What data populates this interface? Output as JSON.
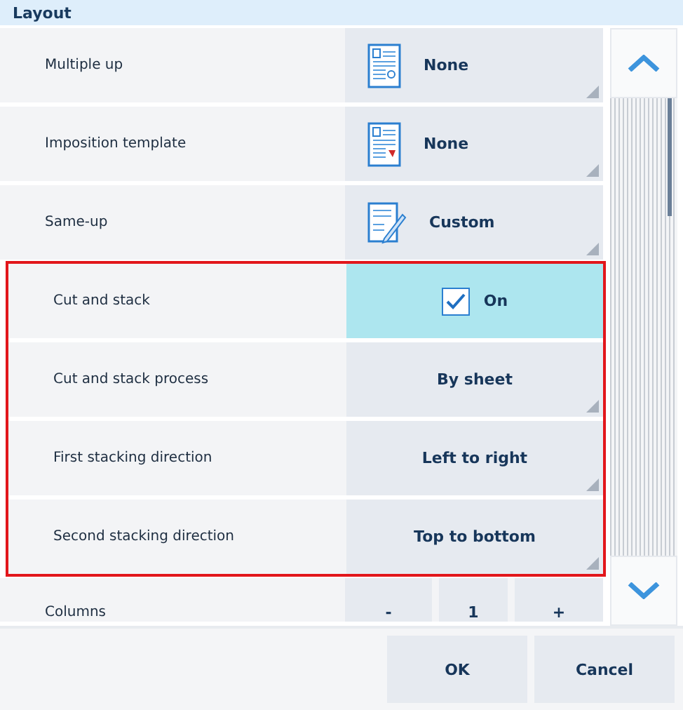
{
  "title": "Layout",
  "rows": [
    {
      "kind": "select",
      "label": "Multiple up",
      "value": "None",
      "highlighted": false
    },
    {
      "kind": "select",
      "label": "Imposition template",
      "value": "None",
      "highlighted": false
    },
    {
      "kind": "select",
      "label": "Same-up",
      "value": "Custom",
      "highlighted": false
    },
    {
      "kind": "checkbox",
      "label": "Cut and stack",
      "value": "On",
      "checked": true,
      "highlighted": true
    },
    {
      "kind": "select",
      "label": "Cut and stack process",
      "value": "By sheet",
      "highlighted": true
    },
    {
      "kind": "select",
      "label": "First stacking direction",
      "value": "Left to right",
      "highlighted": true
    },
    {
      "kind": "select",
      "label": "Second stacking direction",
      "value": "Top to bottom",
      "highlighted": true
    },
    {
      "kind": "stepper",
      "label": "Columns",
      "minus": "-",
      "value": "1",
      "plus": "+",
      "highlighted": false
    }
  ],
  "buttons": [
    {
      "label": "OK"
    },
    {
      "label": "Cancel"
    }
  ]
}
